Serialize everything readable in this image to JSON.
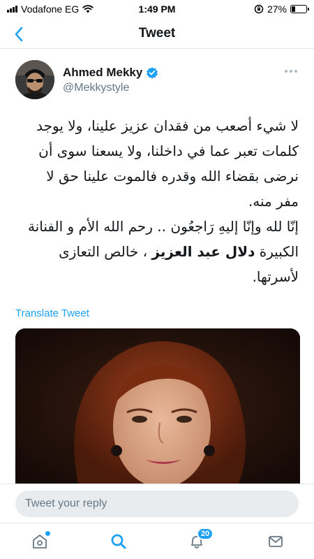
{
  "status_bar": {
    "carrier": "Vodafone EG",
    "time": "1:49 PM",
    "battery": "27%",
    "battery_level": 0.27
  },
  "nav": {
    "title": "Tweet"
  },
  "tweet": {
    "author_name": "Ahmed Mekky",
    "handle": "@Mekkystyle",
    "verified": true,
    "text_lines": [
      "لا شيء أصعب من فقدان عزيز علينا، ولا يوجد",
      "كلمات تعبر عما في داخلنا، ولا يسعنا سوى أن",
      "نرضى بقضاء الله وقدره فالموت علينا حق لا",
      "مفر منه.",
      "إنّا لله وإنّا إليهِ رَاجعُون .. رحم الله الأم و الفنانة"
    ],
    "last_line_prefix": "الكبيرة",
    "last_line_bold": "دلال عبد العزيز",
    "last_line_suffix": "، خالص التعازى",
    "final_line": "لأسرتها.",
    "translate_label": "Translate Tweet"
  },
  "reply": {
    "placeholder": "Tweet your reply"
  },
  "tab_bar": {
    "notifications_count": "20"
  },
  "colors": {
    "accent": "#1da1f2",
    "text": "#14171a",
    "muted": "#657786"
  }
}
